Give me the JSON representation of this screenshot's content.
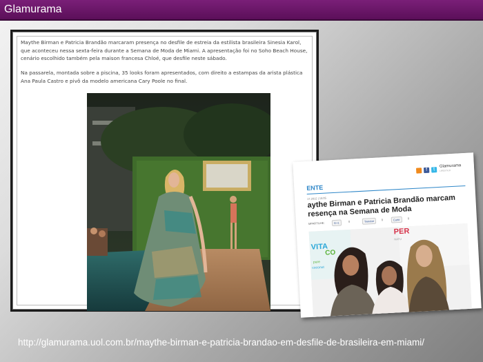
{
  "window": {
    "title": "Glamurama"
  },
  "article": {
    "paragraph1": "Maythe Birman e Patricia Brandão marcaram presença no desfile de estreia da estilista brasileira Sinesia Karol, que aconteceu nessa sexta-feira durante a Semana de Moda de Miami. A apresentação foi no Soho Beach House, cenário escolhido também pela maison francesa Chloé, que desfile neste sábado.",
    "paragraph2": "Na passarela, montada sobre a piscina, 35 looks foram apresentados, com direito a estampas da arista plástica Ana Paula Castro e pivô da modelo americana Cary Poole no final."
  },
  "clipping": {
    "brand": "Glamurama",
    "brand_sub": "LIFESTYLE",
    "section": "ENTE",
    "date": "17.2012 | 15:05",
    "headline": "aythe Birman e Patricia Brandão marcam resença na Semana de Moda",
    "share_label": "MPARTILHE:",
    "share_buttons": [
      {
        "label": "G+1",
        "count": "0"
      },
      {
        "label": "Tweetar",
        "count": "0"
      },
      {
        "label": "Curtir",
        "count": "0"
      }
    ],
    "bg_text_1": "VITA",
    "bg_text_2": "CO",
    "bg_text_3": "pure",
    "bg_text_4": "coconut",
    "bg_text_5": "PER",
    "bg_text_6": "NATU"
  },
  "source": {
    "url": "http://glamurama.uol.com.br/maythe-birman-e-patricia-brandao-em-desfile-de-brasileira-em-miami/"
  },
  "colors": {
    "title_bar": "#6a1768",
    "section_accent": "#2d86c8",
    "url_text": "#ffffff"
  },
  "icons": [
    "rss-icon",
    "facebook-icon",
    "twitter-icon"
  ]
}
